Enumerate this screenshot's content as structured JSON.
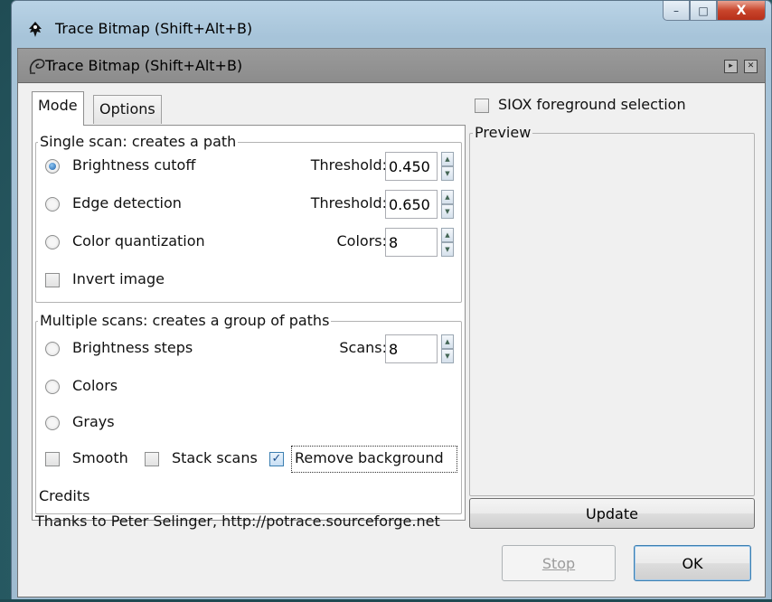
{
  "window": {
    "title": "Trace Bitmap (Shift+Alt+B)",
    "caption_minimize": "–",
    "caption_maximize": "□",
    "caption_close": "X"
  },
  "dock": {
    "title": "Trace Bitmap (Shift+Alt+B)",
    "float_btn": "▸",
    "close_btn": "✕"
  },
  "tabs": [
    {
      "label": "Mode",
      "active": true
    },
    {
      "label": "Options",
      "active": false
    }
  ],
  "single_scan": {
    "legend": "Single scan: creates a path",
    "brightness_cutoff": {
      "label": "Brightness cutoff",
      "checked": true,
      "field_label": "Threshold:",
      "value": "0.450"
    },
    "edge_detection": {
      "label": "Edge detection",
      "checked": false,
      "field_label": "Threshold:",
      "value": "0.650"
    },
    "color_quantization": {
      "label": "Color quantization",
      "checked": false,
      "field_label": "Colors:",
      "value": "8"
    },
    "invert_image": {
      "label": "Invert image",
      "checked": false
    }
  },
  "multiple_scans": {
    "legend": "Multiple scans: creates a group of paths",
    "brightness_steps": {
      "label": "Brightness steps",
      "checked": false,
      "field_label": "Scans:",
      "value": "8"
    },
    "colors": {
      "label": "Colors",
      "checked": false
    },
    "grays": {
      "label": "Grays",
      "checked": false
    },
    "smooth": {
      "label": "Smooth",
      "checked": false
    },
    "stack_scans": {
      "label": "Stack scans",
      "checked": false
    },
    "remove_background": {
      "label": "Remove background",
      "checked": true
    }
  },
  "credits": {
    "title": "Credits",
    "text": "Thanks to Peter Selinger, http://potrace.sourceforge.net"
  },
  "siox": {
    "label": "SIOX foreground selection",
    "checked": false
  },
  "preview": {
    "legend": "Preview"
  },
  "buttons": {
    "update": "Update",
    "stop": "Stop",
    "ok": "OK"
  },
  "colors": {
    "titlebar": "#b9d3e6",
    "dock_header": "#9a9a9a",
    "radio_checked": "#1a5fa8",
    "close_button": "#c9452c"
  }
}
